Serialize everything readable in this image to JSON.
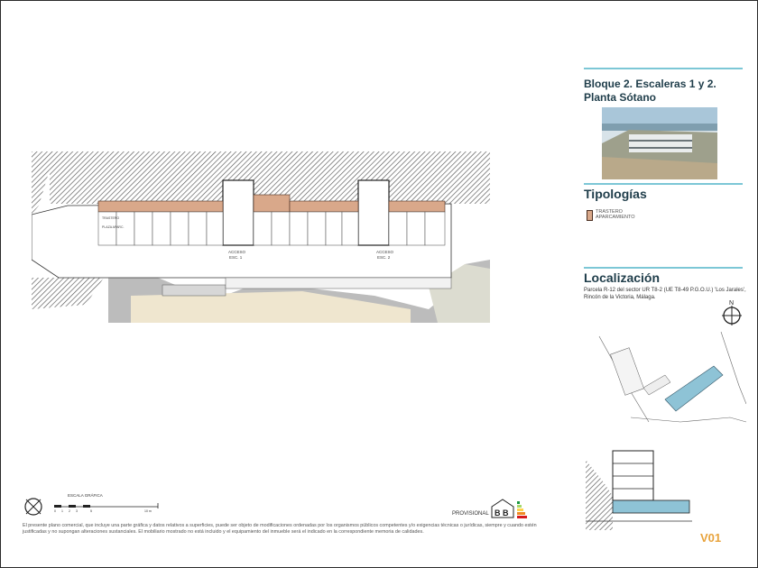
{
  "header": {
    "title": "Bloque 2. Escaleras 1 y 2. Planta Sótano"
  },
  "tipologias": {
    "heading": "Tipologías",
    "legend": [
      {
        "label": "TRASTERO",
        "color": "#d9a88a"
      },
      {
        "label": "APARCAMIENTO",
        "color": "#ffffff"
      }
    ]
  },
  "localizacion": {
    "heading": "Localización",
    "text": "Parcela R-12 del sector UR T8-2 (UE T8-49 P.G.O.U.) 'Los Jarales', Rincón de la Victoria, Málaga."
  },
  "plan": {
    "trastero_label": "TRASTERO",
    "plaza_label": "PLAZA APARC.",
    "access1": [
      "ACCESO",
      "ESC. 1"
    ],
    "access2": [
      "ACCESO",
      "ESC. 2"
    ]
  },
  "scale": {
    "label": "ESCALA GRÁFICA",
    "ticks": [
      "0",
      "1",
      "2",
      "3",
      "5",
      "10 m"
    ]
  },
  "footer": {
    "disclaimer": "El presente plano comercial, que incluye una parte gráfica y datos relativos a superficies, puede ser objeto de modificaciones ordenadas por los organismos públicos competentes y/o exigencias técnicas o jurídicas, siempre y cuando estén justificadas y no supongan alteraciones sustanciales. El mobiliario mostrado no está incluido y el equipamiento del inmueble será el indicado en la correspondiente memoria de calidades.",
    "provisional": "PROVISIONAL",
    "energy_letters": "B B",
    "version": "V01"
  },
  "colors": {
    "accent": "#7cc7d6",
    "text": "#1f3d4a",
    "storage": "#d9a88a",
    "version": "#e8a33c"
  },
  "icons": [
    "north-arrow-icon",
    "compass-icon",
    "energy-label-icon"
  ]
}
